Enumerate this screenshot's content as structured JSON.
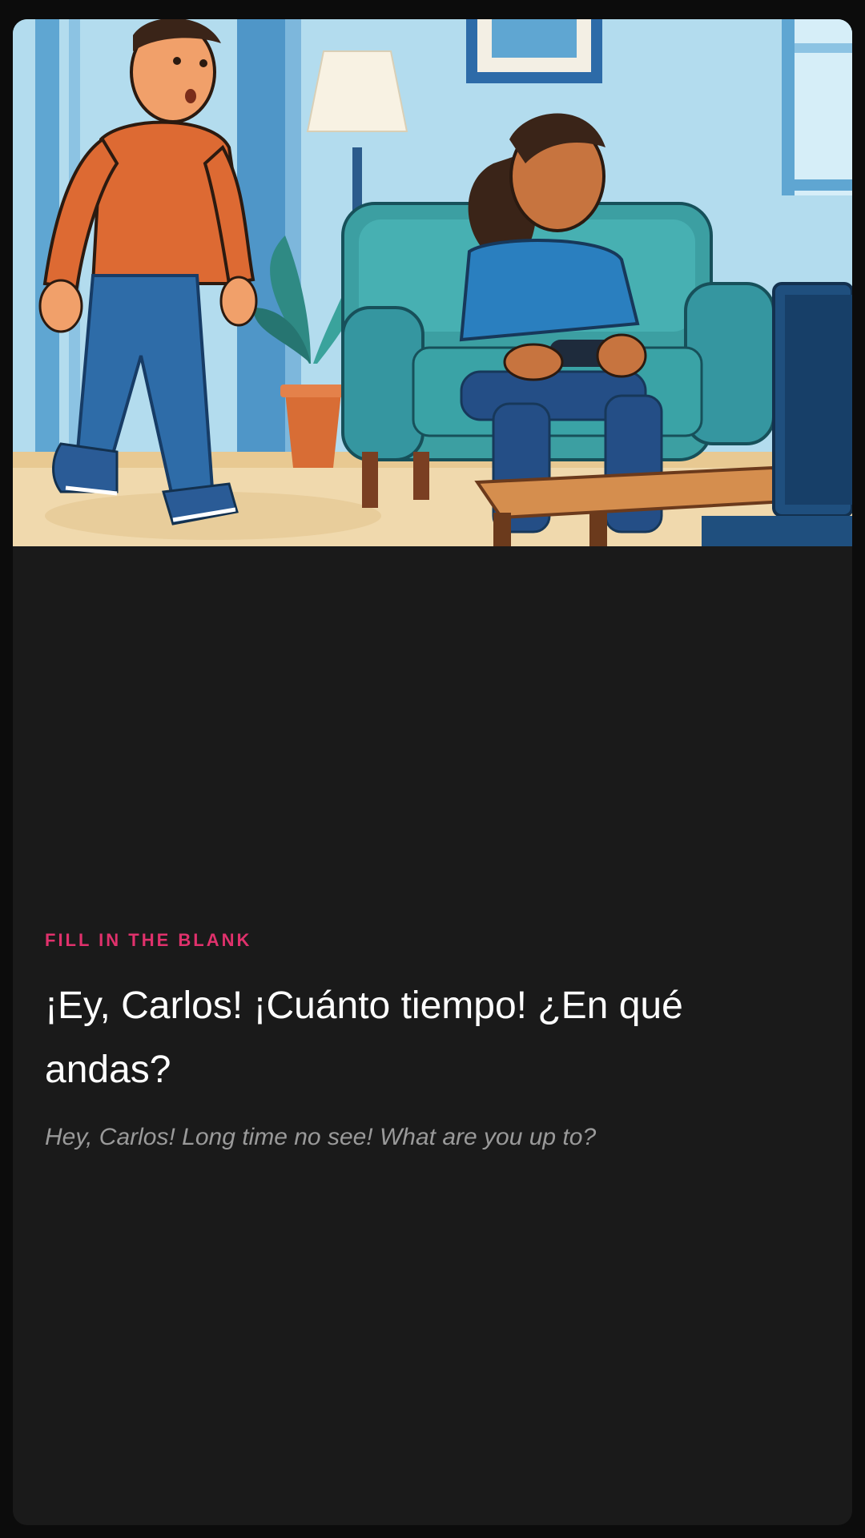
{
  "exercise": {
    "type_label": "FILL IN THE BLANK",
    "sentence": "¡Ey, Carlos! ¡Cuánto tiempo! ¿En qué andas?",
    "translation": "Hey, Carlos! Long time no see! What are you up to?"
  },
  "illustration": {
    "icon": "living-room-scene-illustration"
  },
  "colors": {
    "accent": "#e0316c",
    "card_background": "#1a1a1a",
    "page_background": "#0c0c0c",
    "primary_text": "#ffffff",
    "secondary_text": "#9a9a9a"
  }
}
